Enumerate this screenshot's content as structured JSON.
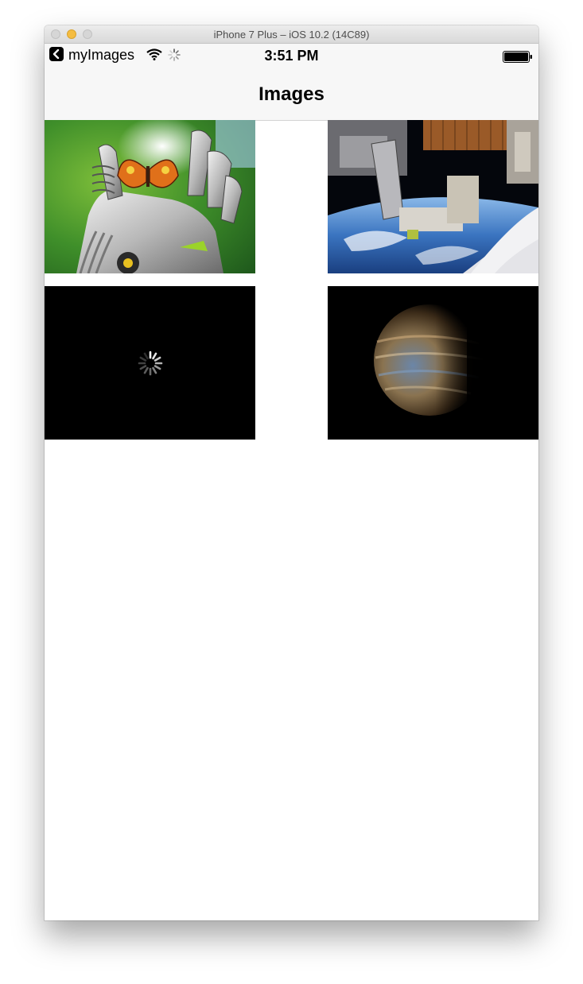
{
  "window": {
    "title": "iPhone 7 Plus – iOS 10.2 (14C89)"
  },
  "status_bar": {
    "back_app": "myImages",
    "time": "3:51 PM",
    "icons": [
      "back-chevron-icon",
      "wifi-icon",
      "activity-spinner-icon",
      "battery-icon"
    ]
  },
  "nav": {
    "title": "Images"
  },
  "grid": {
    "cells": [
      {
        "content": "image",
        "subject": "robot hand holding butterfly"
      },
      {
        "content": "image",
        "subject": "space station over earth"
      },
      {
        "content": "loading",
        "icon": "loading-spinner-icon"
      },
      {
        "content": "image",
        "subject": "planet jupiter"
      }
    ]
  },
  "colors": {
    "traffic_minimize": "#f5bd41",
    "nav_background": "#f7f7f7"
  }
}
